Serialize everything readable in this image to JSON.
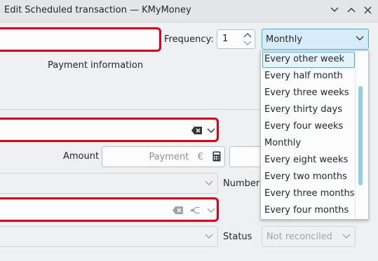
{
  "window": {
    "title": "Edit Scheduled transaction — KMyMoney"
  },
  "schedule": {
    "frequency_label": "Frequency:",
    "frequency_number": "1",
    "frequency_selected": "Monthly",
    "frequency_options": [
      "Every other week",
      "Every half month",
      "Every three weeks",
      "Every thirty days",
      "Every four weeks",
      "Monthly",
      "Every eight weeks",
      "Every two months",
      "Every three months",
      "Every four months"
    ],
    "highlighted_option": "Every other week"
  },
  "form": {
    "payment_info_label": "Payment information",
    "amount_label": "Amount",
    "payment_placeholder": "Payment",
    "currency_symbol": "€",
    "number_label": "Number",
    "status_label": "Status",
    "status_value": "Not reconciled"
  },
  "colors": {
    "error_border": "#e0001b",
    "accent": "#3daee9"
  }
}
